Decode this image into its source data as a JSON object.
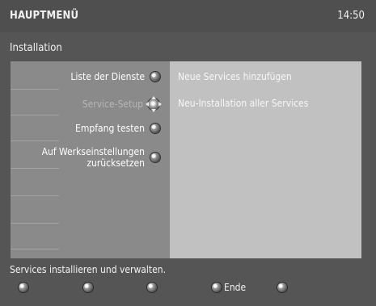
{
  "header": {
    "title": "HAUPTMENÜ",
    "time": "14:50"
  },
  "section": {
    "title": "Installation"
  },
  "menu": {
    "items": [
      {
        "label": "Liste der Dienste",
        "icon": "select-icon"
      },
      {
        "label": "Service-Setup",
        "icon": "navigation-pad-icon"
      },
      {
        "label": "Empfang testen",
        "icon": "select-icon"
      },
      {
        "label_lines": [
          "Auf Werkseinstellungen",
          "zurücksetzen"
        ],
        "icon": "select-icon"
      }
    ]
  },
  "submenu": {
    "items": [
      {
        "label": "Neue Services hinzufügen"
      },
      {
        "label": "Neu-Installation aller Services"
      }
    ]
  },
  "status": {
    "text": "Services installieren und verwalten."
  },
  "buttons": {
    "colored": [
      {
        "name": "red",
        "label": ""
      },
      {
        "name": "green",
        "label": ""
      },
      {
        "name": "yellow",
        "label": ""
      },
      {
        "name": "blue",
        "label": "Ende"
      },
      {
        "name": "white",
        "label": ""
      }
    ]
  }
}
